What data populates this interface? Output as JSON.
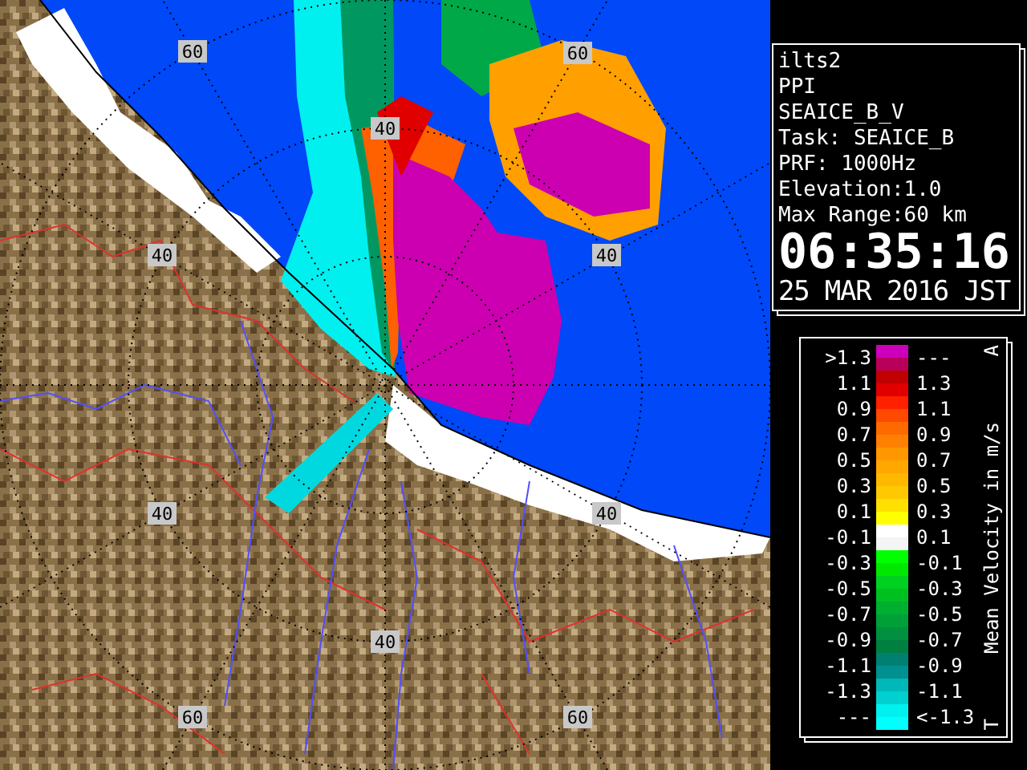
{
  "map": {
    "range_labels": [
      {
        "text": "60"
      },
      {
        "text": "60"
      },
      {
        "text": "40"
      },
      {
        "text": "40"
      },
      {
        "text": "40"
      },
      {
        "text": "40"
      },
      {
        "text": "40"
      },
      {
        "text": "40"
      },
      {
        "text": "60"
      },
      {
        "text": "60"
      }
    ]
  },
  "info": {
    "lines": [
      "ilts2",
      "PPI",
      "SEAICE_B_V",
      "Task: SEAICE_B",
      "PRF: 1000Hz",
      "Elevation:1.0",
      "Max Range:60 km"
    ],
    "time": "06:35:16",
    "date": "25 MAR 2016 JST"
  },
  "legend": {
    "top_mark": "A",
    "title": "Mean Velocity in m/s",
    "bottom_mark": "T",
    "rows": [
      {
        "low": ">1.3",
        "high": "---"
      },
      {
        "low": "1.1",
        "high": "1.3"
      },
      {
        "low": "0.9",
        "high": "1.1"
      },
      {
        "low": "0.7",
        "high": "0.9"
      },
      {
        "low": "0.5",
        "high": "0.7"
      },
      {
        "low": "0.3",
        "high": "0.5"
      },
      {
        "low": "0.1",
        "high": "0.3"
      },
      {
        "low": "-0.1",
        "high": "0.1"
      },
      {
        "low": "-0.3",
        "high": "-0.1"
      },
      {
        "low": "-0.5",
        "high": "-0.3"
      },
      {
        "low": "-0.7",
        "high": "-0.5"
      },
      {
        "low": "-0.9",
        "high": "-0.7"
      },
      {
        "low": "-1.1",
        "high": "-0.9"
      },
      {
        "low": "-1.3",
        "high": "-1.1"
      },
      {
        "low": "---",
        "high": "<-1.3"
      }
    ],
    "bands": [
      {
        "color": "#cc00bb"
      },
      {
        "color": "#b8005a"
      },
      {
        "color": "#c00000"
      },
      {
        "color": "#e00000"
      },
      {
        "color": "#ff2000"
      },
      {
        "color": "#ff4800"
      },
      {
        "color": "#ff6a00"
      },
      {
        "color": "#ff8000"
      },
      {
        "color": "#ff9800"
      },
      {
        "color": "#ffa800"
      },
      {
        "color": "#ffb800"
      },
      {
        "color": "#ffc800"
      },
      {
        "color": "#ffe000"
      },
      {
        "color": "#ffff00"
      },
      {
        "color": "#ffffff"
      },
      {
        "color": "#f4f4f4"
      },
      {
        "color": "#00ff00"
      },
      {
        "color": "#00e800"
      },
      {
        "color": "#00d020"
      },
      {
        "color": "#00c020"
      },
      {
        "color": "#00b030"
      },
      {
        "color": "#00a038"
      },
      {
        "color": "#009040"
      },
      {
        "color": "#008040"
      },
      {
        "color": "#008070"
      },
      {
        "color": "#009090"
      },
      {
        "color": "#00b8b8"
      },
      {
        "color": "#00d0d0"
      },
      {
        "color": "#00f0f0"
      },
      {
        "color": "#00ffff"
      }
    ]
  }
}
